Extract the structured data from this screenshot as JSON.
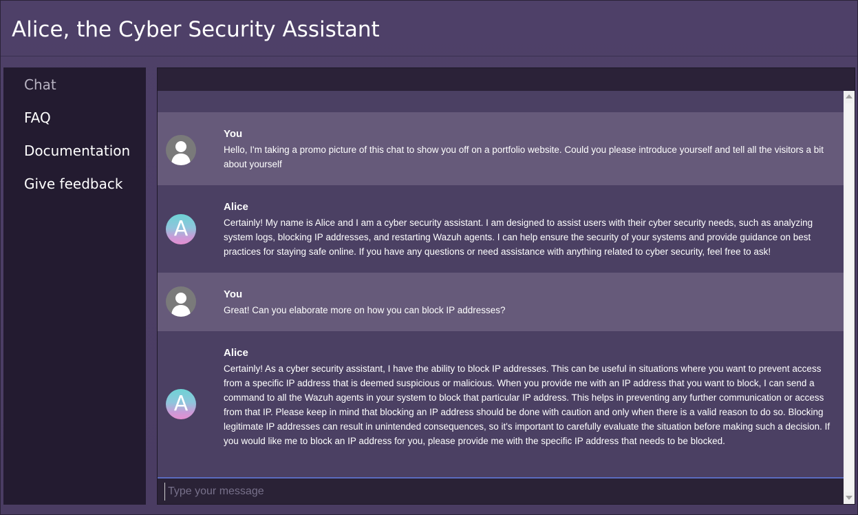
{
  "app": {
    "title": "Alice, the Cyber Security Assistant"
  },
  "sidebar": {
    "items": [
      {
        "label": "Chat",
        "active": true
      },
      {
        "label": "FAQ",
        "active": false
      },
      {
        "label": "Documentation",
        "active": false
      },
      {
        "label": "Give feedback",
        "active": false
      }
    ]
  },
  "chat": {
    "messages": [
      {
        "role": "user",
        "author": "You",
        "avatar_icon": "user-silhouette-icon",
        "text": "Hello, I'm taking a promo picture of this chat to show you off on a portfolio website. Could you please introduce yourself and tell all the visitors a bit about yourself"
      },
      {
        "role": "bot",
        "author": "Alice",
        "avatar_letter": "A",
        "text": "Certainly! My name is Alice and I am a cyber security assistant. I am designed to assist users with their cyber security needs, such as analyzing system logs, blocking IP addresses, and restarting Wazuh agents. I can help ensure the security of your systems and provide guidance on best practices for staying safe online. If you have any questions or need assistance with anything related to cyber security, feel free to ask!"
      },
      {
        "role": "user",
        "author": "You",
        "avatar_icon": "user-silhouette-icon",
        "text": "Great! Can you elaborate more on how you can block IP addresses?"
      },
      {
        "role": "bot",
        "author": "Alice",
        "avatar_letter": "A",
        "text": "Certainly! As a cyber security assistant, I have the ability to block IP addresses. This can be useful in situations where you want to prevent access from a specific IP address that is deemed suspicious or malicious. When you provide me with an IP address that you want to block, I can send a command to all the Wazuh agents in your system to block that particular IP address. This helps in preventing any further communication or access from that IP. Please keep in mind that blocking an IP address should be done with caution and only when there is a valid reason to do so. Blocking legitimate IP addresses can result in unintended consequences, so it's important to carefully evaluate the situation before making such a decision. If you would like me to block an IP address for you, please provide me with the specific IP address that needs to be blocked."
      }
    ],
    "input": {
      "placeholder": "Type your message",
      "value": ""
    }
  },
  "colors": {
    "background": "#4a3d63",
    "sidebar": "#231b30",
    "user_message": "#665a7a",
    "bot_message": "#4b4063",
    "input_focus": "#5b6cc0"
  }
}
